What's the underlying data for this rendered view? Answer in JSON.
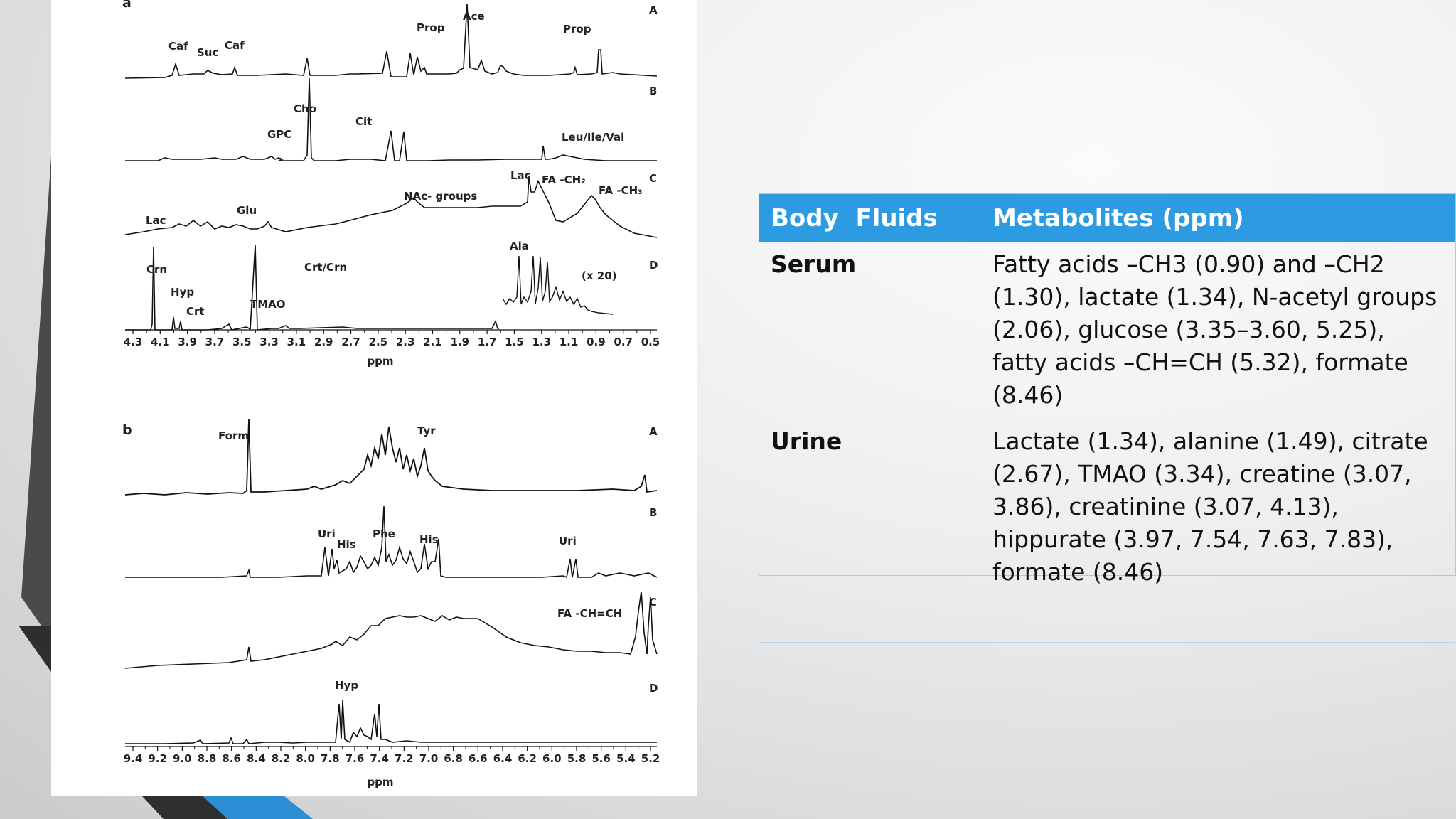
{
  "figure": {
    "panel_a": {
      "label": "a",
      "traces": [
        "A",
        "B",
        "C",
        "D"
      ],
      "peaks": [
        "Caf",
        "Suc",
        "Caf",
        "Prop",
        "Ace",
        "Prop",
        "Cho",
        "GPC",
        "Cit",
        "Leu/Ile/Val",
        "Lac",
        "FA -CH₂",
        "FA -CH₃",
        "NAc- groups",
        "Lac",
        "Glu",
        "Ala",
        "(x 20)",
        "Crn",
        "Hyp",
        "Crt",
        "TMAO",
        "Crt/Crn"
      ],
      "axis_ticks": [
        "4.3",
        "4.1",
        "3.9",
        "3.7",
        "3.5",
        "3.3",
        "3.1",
        "2.9",
        "2.7",
        "2.5",
        "2.3",
        "2.1",
        "1.9",
        "1.7",
        "1.5",
        "1.3",
        "1.1",
        "0.9",
        "0.7",
        "0.5"
      ],
      "axis_label": "ppm"
    },
    "panel_b": {
      "label": "b",
      "traces": [
        "A",
        "B",
        "C",
        "D"
      ],
      "peaks": [
        "Form",
        "Tyr",
        "Uri",
        "His",
        "Phe",
        "His",
        "Uri",
        "FA -CH=CH",
        "Hyp"
      ],
      "axis_ticks": [
        "9.4",
        "9.2",
        "9.0",
        "8.8",
        "8.6",
        "8.4",
        "8.2",
        "8.0",
        "7.8",
        "7.6",
        "7.4",
        "7.2",
        "7.0",
        "6.8",
        "6.6",
        "6.4",
        "6.2",
        "6.0",
        "5.8",
        "5.6",
        "5.4",
        "5.2"
      ],
      "axis_label": "ppm"
    }
  },
  "table": {
    "headers": [
      "Body  Fluids",
      "Metabolites (ppm)"
    ],
    "rows": [
      {
        "fluid": "Serum",
        "metabolites": "Fatty acids –CH3 (0.90) and –CH2 (1.30), lactate (1.34), N-acetyl groups (2.06), glucose (3.35–3.60, 5.25), fatty acids –CH=CH (5.32), formate (8.46)"
      },
      {
        "fluid": "Urine",
        "metabolites": "Lactate (1.34), alanine (1.49), citrate (2.67), TMAO (3.34), creatine (3.07, 3.86), creatinine (3.07, 4.13), hippurate (3.97, 7.54, 7.63, 7.83), formate (8.46)"
      },
      {
        "fluid": "",
        "metabolites": ""
      }
    ]
  },
  "colors": {
    "header_bg": "#2c9be2",
    "deco_dark": "#3a3a3a",
    "deco_blue": "#2c8fd6"
  }
}
